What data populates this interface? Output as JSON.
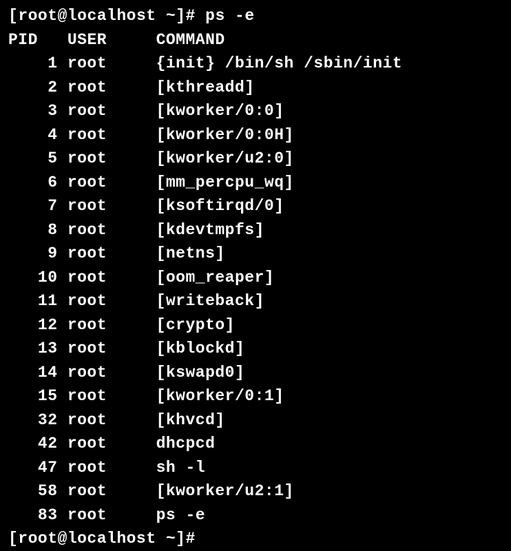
{
  "prompt": {
    "user": "root",
    "host": "localhost",
    "cwd": "~",
    "symbol": "#",
    "command": "ps -e"
  },
  "header": {
    "pid": "PID",
    "user": "USER",
    "command": "COMMAND"
  },
  "processes": [
    {
      "pid": "1",
      "user": "root",
      "command": "{init} /bin/sh /sbin/init"
    },
    {
      "pid": "2",
      "user": "root",
      "command": "[kthreadd]"
    },
    {
      "pid": "3",
      "user": "root",
      "command": "[kworker/0:0]"
    },
    {
      "pid": "4",
      "user": "root",
      "command": "[kworker/0:0H]"
    },
    {
      "pid": "5",
      "user": "root",
      "command": "[kworker/u2:0]"
    },
    {
      "pid": "6",
      "user": "root",
      "command": "[mm_percpu_wq]"
    },
    {
      "pid": "7",
      "user": "root",
      "command": "[ksoftirqd/0]"
    },
    {
      "pid": "8",
      "user": "root",
      "command": "[kdevtmpfs]"
    },
    {
      "pid": "9",
      "user": "root",
      "command": "[netns]"
    },
    {
      "pid": "10",
      "user": "root",
      "command": "[oom_reaper]"
    },
    {
      "pid": "11",
      "user": "root",
      "command": "[writeback]"
    },
    {
      "pid": "12",
      "user": "root",
      "command": "[crypto]"
    },
    {
      "pid": "13",
      "user": "root",
      "command": "[kblockd]"
    },
    {
      "pid": "14",
      "user": "root",
      "command": "[kswapd0]"
    },
    {
      "pid": "15",
      "user": "root",
      "command": "[kworker/0:1]"
    },
    {
      "pid": "32",
      "user": "root",
      "command": "[khvcd]"
    },
    {
      "pid": "42",
      "user": "root",
      "command": "dhcpcd"
    },
    {
      "pid": "47",
      "user": "root",
      "command": "sh -l"
    },
    {
      "pid": "58",
      "user": "root",
      "command": "[kworker/u2:1]"
    },
    {
      "pid": "83",
      "user": "root",
      "command": "ps -e"
    }
  ],
  "prompt_after": {
    "text": "[root@localhost ~]# "
  }
}
